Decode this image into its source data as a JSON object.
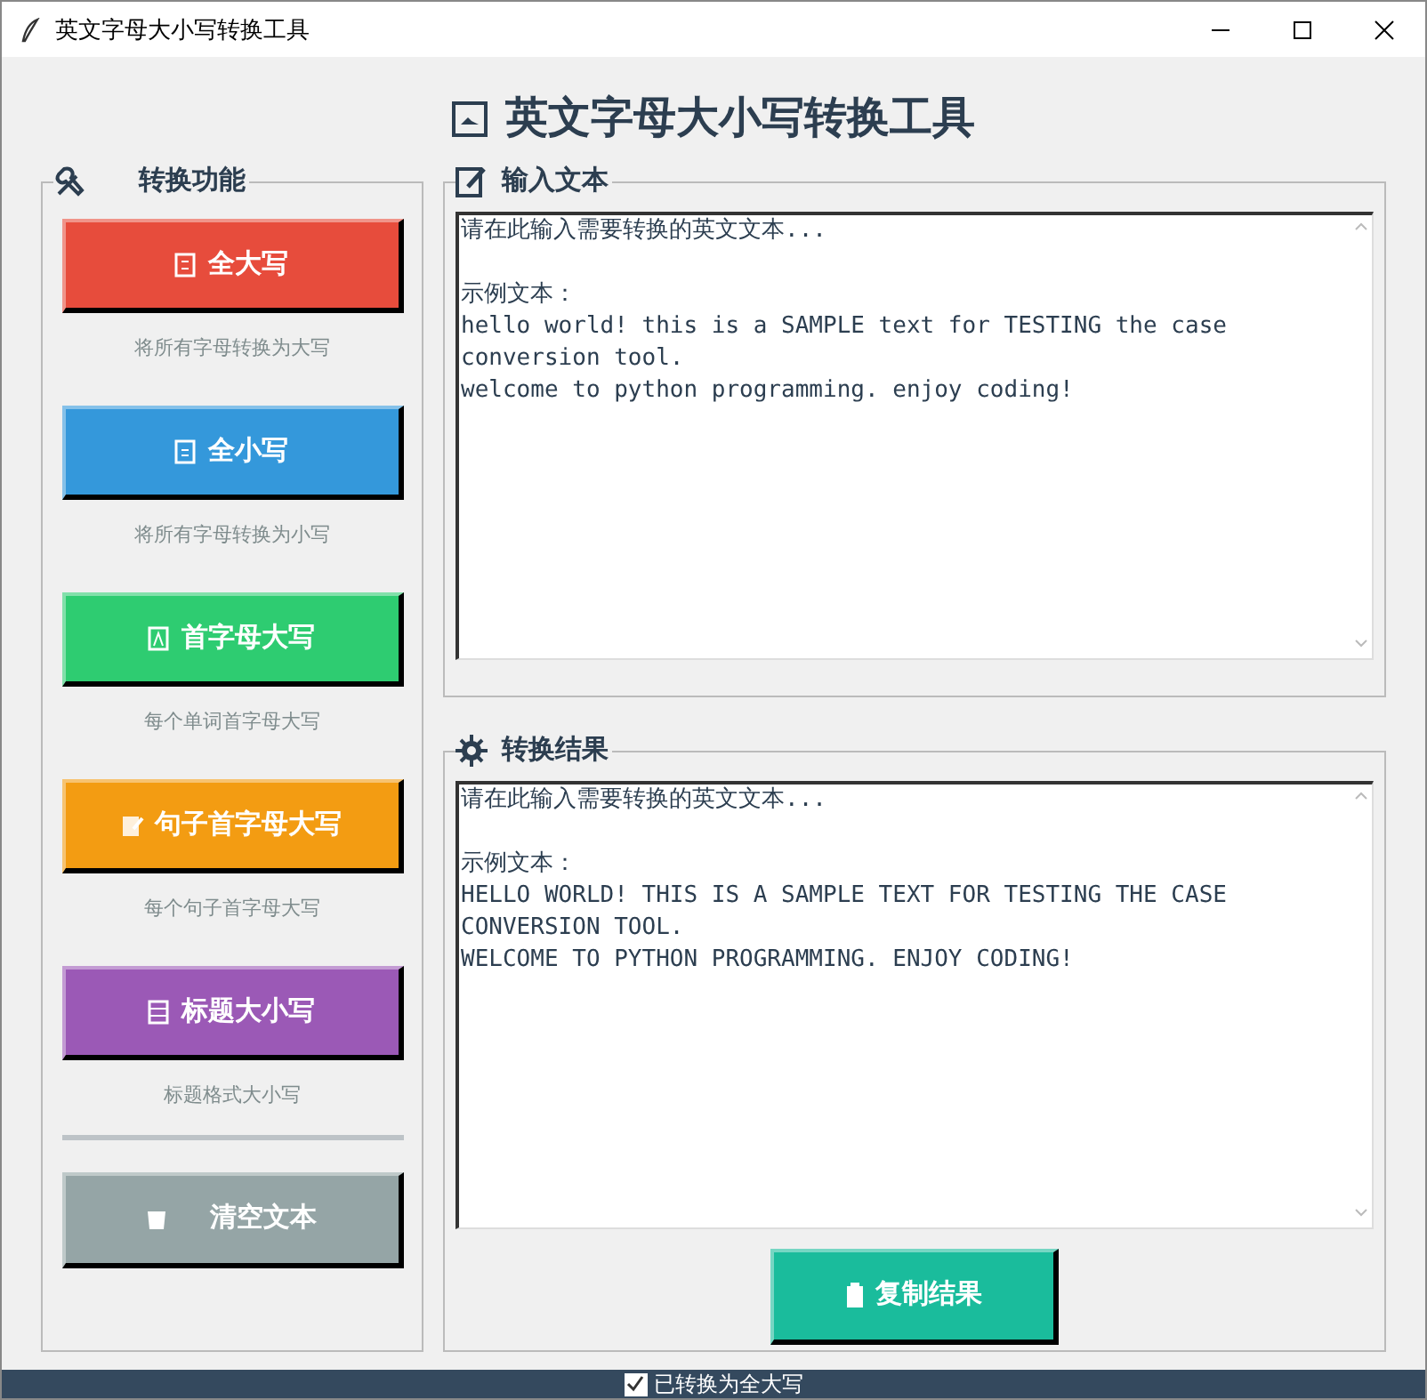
{
  "window": {
    "title": "英文字母大小写转换工具"
  },
  "header": {
    "title": "英文字母大小写转换工具"
  },
  "functions": {
    "title": "转换功能",
    "buttons": [
      {
        "label": "全大写",
        "description": "将所有字母转换为大写",
        "color": "#e74c3c",
        "kind": "upper"
      },
      {
        "label": "全小写",
        "description": "将所有字母转换为小写",
        "color": "#3498db",
        "kind": "lower"
      },
      {
        "label": "首字母大写",
        "description": "每个单词首字母大写",
        "color": "#2ecc71",
        "kind": "capital"
      },
      {
        "label": "句子首字母大写",
        "description": "每个句子首字母大写",
        "color": "#f39c12",
        "kind": "sentence"
      },
      {
        "label": "标题大小写",
        "description": "标题格式大小写",
        "color": "#9b59b6",
        "kind": "title"
      }
    ],
    "clear_button": {
      "label": "清空文本",
      "color": "#95a5a6"
    }
  },
  "input": {
    "title": "输入文本",
    "lines": [
      "请在此输入需要转换的英文文本...",
      "示例文本：",
      "hello world! this is a SAMPLE text for TESTING the case",
      "conversion tool.",
      "welcome to python programming. enjoy coding!"
    ]
  },
  "result": {
    "title": "转换结果",
    "lines": [
      "请在此输入需要转换的英文文本...",
      "示例文本：",
      "HELLO WORLD! THIS IS A SAMPLE TEXT FOR TESTING THE CASE",
      "CONVERSION TOOL.",
      "WELCOME TO PYTHON PROGRAMMING. ENJOY CODING!"
    ]
  },
  "copy_button": {
    "label": "复制结果",
    "color": "#1abc9c"
  },
  "status_bar": {
    "text": "已转换为全大写",
    "checked": true
  }
}
